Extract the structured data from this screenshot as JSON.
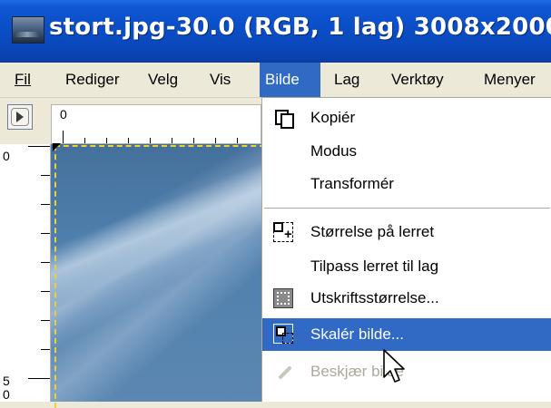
{
  "window": {
    "title": "stort.jpg-30.0 (RGB, 1 lag) 3008x2000",
    "app_icon": "gimp-image-icon"
  },
  "menubar": {
    "items": [
      {
        "label": "Fil",
        "underline": "F"
      },
      {
        "label": "Rediger",
        "underline": "R"
      },
      {
        "label": "Velg",
        "underline": "V"
      },
      {
        "label": "Vis",
        "underline": "V"
      },
      {
        "label": "Bilde",
        "underline": "B",
        "active": true
      },
      {
        "label": "Lag",
        "underline": "L"
      },
      {
        "label": "Verktøy",
        "underline": "V"
      },
      {
        "label": "Menyer",
        "underline": "M"
      }
    ]
  },
  "rulers": {
    "horizontal_start": "0",
    "vertical_start": "0",
    "vertical_mark": "5",
    "vertical_mark2": "0"
  },
  "dropdown": {
    "items": [
      {
        "label": "Kopiér",
        "icon": "duplicate-icon"
      },
      {
        "label": "Modus",
        "icon": ""
      },
      {
        "label": "Transformér",
        "icon": ""
      },
      {
        "label": "Størrelse på lerret",
        "icon": "canvas-size-icon"
      },
      {
        "label": "Tilpass lerret til lag",
        "icon": ""
      },
      {
        "label": "Utskriftsstørrelse...",
        "icon": "print-size-icon"
      },
      {
        "label": "Skalér bilde...",
        "icon": "scale-image-icon",
        "highlighted": true
      },
      {
        "label": "Beskjær bilde",
        "icon": "crop-icon",
        "disabled": true
      }
    ]
  },
  "colors": {
    "titlebar": "#0b4fc8",
    "menu_highlight": "#316ac5",
    "menu_bg": "#ece9d8",
    "disabled_text": "#aca899",
    "selection_dash": "#e8d23a"
  }
}
